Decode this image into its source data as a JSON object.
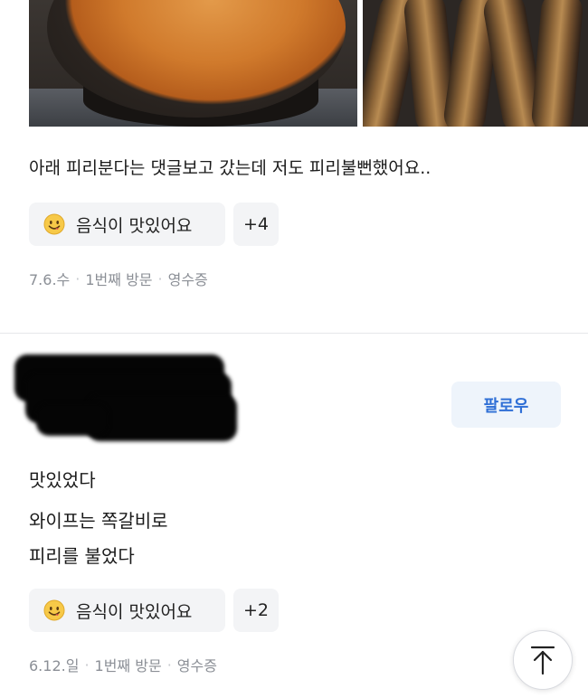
{
  "review1": {
    "text": "아래 피리분다는 댓글보고 갔는데 저도 피리불뻔했어요..",
    "tag_main_label": "음식이 맛있어요",
    "tag_more": "+4",
    "meta": {
      "date": "7.6.수",
      "visit": "1번째 방문",
      "receipt": "영수증"
    }
  },
  "review2": {
    "follow_label": "팔로우",
    "lines": [
      "맛있었다",
      "와이프는 쪽갈비로",
      "피리를 불었다"
    ],
    "tag_main_label": "음식이 맛있어요",
    "tag_more": "+2",
    "meta": {
      "date": "6.12.일",
      "visit": "1번째 방문",
      "receipt": "영수증"
    }
  },
  "icons": {
    "tag_emoji": "smiling-face-icon",
    "scroll_top": "arrow-up-to-top-icon"
  },
  "colors": {
    "follow_text": "#2f6fd6",
    "follow_bg": "#eef4fb",
    "tag_bg": "#f3f4f6",
    "meta_text": "#8b8f96"
  }
}
